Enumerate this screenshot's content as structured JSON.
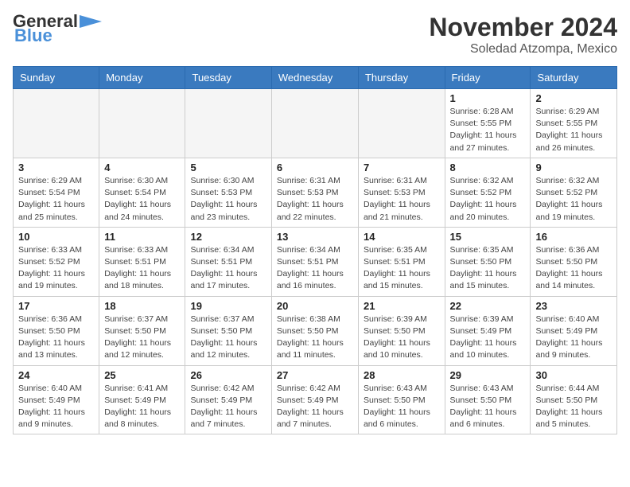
{
  "header": {
    "logo_general": "General",
    "logo_blue": "Blue",
    "month": "November 2024",
    "location": "Soledad Atzompa, Mexico"
  },
  "weekdays": [
    "Sunday",
    "Monday",
    "Tuesday",
    "Wednesday",
    "Thursday",
    "Friday",
    "Saturday"
  ],
  "weeks": [
    [
      {
        "day": "",
        "empty": true
      },
      {
        "day": "",
        "empty": true
      },
      {
        "day": "",
        "empty": true
      },
      {
        "day": "",
        "empty": true
      },
      {
        "day": "",
        "empty": true
      },
      {
        "day": "1",
        "info": "Sunrise: 6:28 AM\nSunset: 5:55 PM\nDaylight: 11 hours and 27 minutes."
      },
      {
        "day": "2",
        "info": "Sunrise: 6:29 AM\nSunset: 5:55 PM\nDaylight: 11 hours and 26 minutes."
      }
    ],
    [
      {
        "day": "3",
        "info": "Sunrise: 6:29 AM\nSunset: 5:54 PM\nDaylight: 11 hours and 25 minutes."
      },
      {
        "day": "4",
        "info": "Sunrise: 6:30 AM\nSunset: 5:54 PM\nDaylight: 11 hours and 24 minutes."
      },
      {
        "day": "5",
        "info": "Sunrise: 6:30 AM\nSunset: 5:53 PM\nDaylight: 11 hours and 23 minutes."
      },
      {
        "day": "6",
        "info": "Sunrise: 6:31 AM\nSunset: 5:53 PM\nDaylight: 11 hours and 22 minutes."
      },
      {
        "day": "7",
        "info": "Sunrise: 6:31 AM\nSunset: 5:53 PM\nDaylight: 11 hours and 21 minutes."
      },
      {
        "day": "8",
        "info": "Sunrise: 6:32 AM\nSunset: 5:52 PM\nDaylight: 11 hours and 20 minutes."
      },
      {
        "day": "9",
        "info": "Sunrise: 6:32 AM\nSunset: 5:52 PM\nDaylight: 11 hours and 19 minutes."
      }
    ],
    [
      {
        "day": "10",
        "info": "Sunrise: 6:33 AM\nSunset: 5:52 PM\nDaylight: 11 hours and 19 minutes."
      },
      {
        "day": "11",
        "info": "Sunrise: 6:33 AM\nSunset: 5:51 PM\nDaylight: 11 hours and 18 minutes."
      },
      {
        "day": "12",
        "info": "Sunrise: 6:34 AM\nSunset: 5:51 PM\nDaylight: 11 hours and 17 minutes."
      },
      {
        "day": "13",
        "info": "Sunrise: 6:34 AM\nSunset: 5:51 PM\nDaylight: 11 hours and 16 minutes."
      },
      {
        "day": "14",
        "info": "Sunrise: 6:35 AM\nSunset: 5:51 PM\nDaylight: 11 hours and 15 minutes."
      },
      {
        "day": "15",
        "info": "Sunrise: 6:35 AM\nSunset: 5:50 PM\nDaylight: 11 hours and 15 minutes."
      },
      {
        "day": "16",
        "info": "Sunrise: 6:36 AM\nSunset: 5:50 PM\nDaylight: 11 hours and 14 minutes."
      }
    ],
    [
      {
        "day": "17",
        "info": "Sunrise: 6:36 AM\nSunset: 5:50 PM\nDaylight: 11 hours and 13 minutes."
      },
      {
        "day": "18",
        "info": "Sunrise: 6:37 AM\nSunset: 5:50 PM\nDaylight: 11 hours and 12 minutes."
      },
      {
        "day": "19",
        "info": "Sunrise: 6:37 AM\nSunset: 5:50 PM\nDaylight: 11 hours and 12 minutes."
      },
      {
        "day": "20",
        "info": "Sunrise: 6:38 AM\nSunset: 5:50 PM\nDaylight: 11 hours and 11 minutes."
      },
      {
        "day": "21",
        "info": "Sunrise: 6:39 AM\nSunset: 5:50 PM\nDaylight: 11 hours and 10 minutes."
      },
      {
        "day": "22",
        "info": "Sunrise: 6:39 AM\nSunset: 5:49 PM\nDaylight: 11 hours and 10 minutes."
      },
      {
        "day": "23",
        "info": "Sunrise: 6:40 AM\nSunset: 5:49 PM\nDaylight: 11 hours and 9 minutes."
      }
    ],
    [
      {
        "day": "24",
        "info": "Sunrise: 6:40 AM\nSunset: 5:49 PM\nDaylight: 11 hours and 9 minutes."
      },
      {
        "day": "25",
        "info": "Sunrise: 6:41 AM\nSunset: 5:49 PM\nDaylight: 11 hours and 8 minutes."
      },
      {
        "day": "26",
        "info": "Sunrise: 6:42 AM\nSunset: 5:49 PM\nDaylight: 11 hours and 7 minutes."
      },
      {
        "day": "27",
        "info": "Sunrise: 6:42 AM\nSunset: 5:49 PM\nDaylight: 11 hours and 7 minutes."
      },
      {
        "day": "28",
        "info": "Sunrise: 6:43 AM\nSunset: 5:50 PM\nDaylight: 11 hours and 6 minutes."
      },
      {
        "day": "29",
        "info": "Sunrise: 6:43 AM\nSunset: 5:50 PM\nDaylight: 11 hours and 6 minutes."
      },
      {
        "day": "30",
        "info": "Sunrise: 6:44 AM\nSunset: 5:50 PM\nDaylight: 11 hours and 5 minutes."
      }
    ]
  ]
}
